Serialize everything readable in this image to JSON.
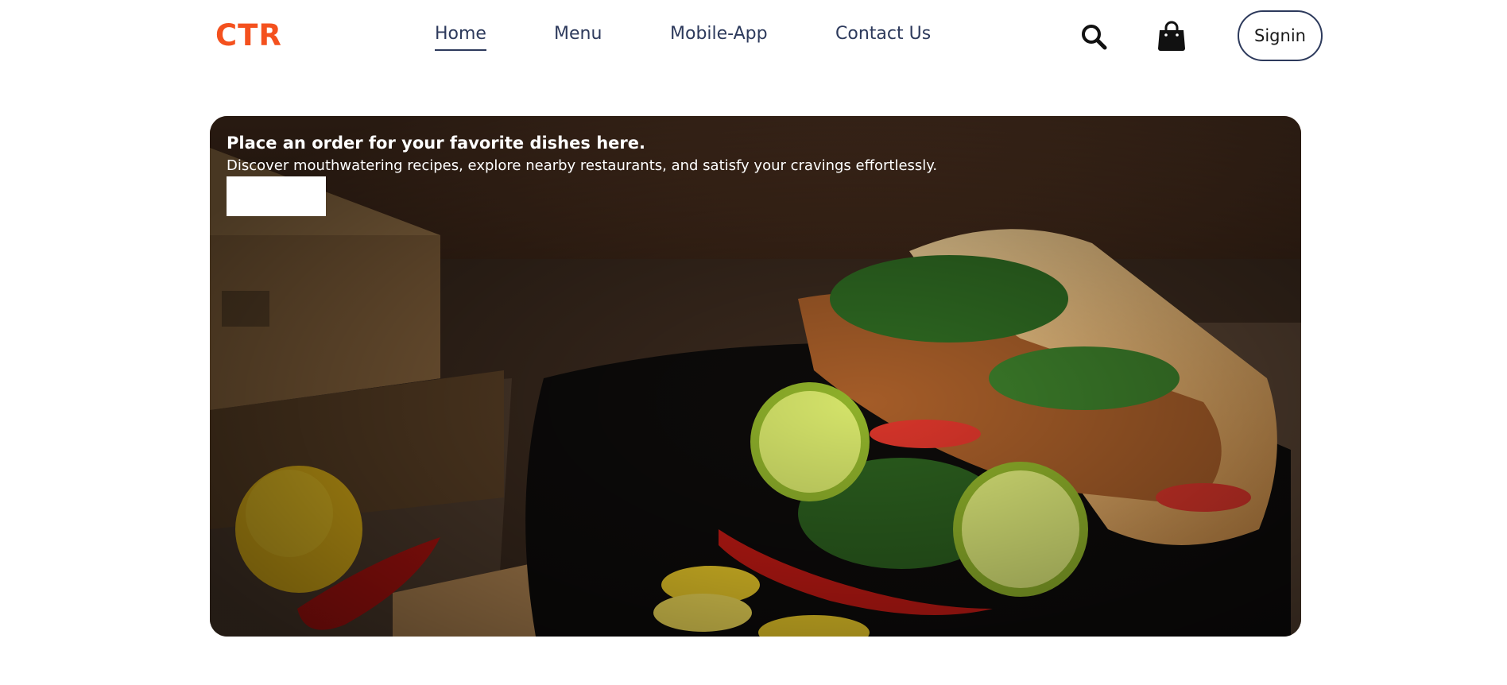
{
  "brand": {
    "logo_text": "CTR",
    "logo_color": "#f4511e"
  },
  "nav": {
    "items": [
      {
        "label": "Home",
        "active": true
      },
      {
        "label": "Menu",
        "active": false
      },
      {
        "label": "Mobile-App",
        "active": false
      },
      {
        "label": "Contact Us",
        "active": false
      }
    ],
    "text_color": "#2d3a5c"
  },
  "header_actions": {
    "search_icon": "search-icon",
    "bag_icon": "shopping-bag-icon",
    "signin_label": "Signin"
  },
  "hero": {
    "title": "Place an order for your favorite dishes here.",
    "subtitle": "Discover mouthwatering recipes, explore nearby restaurants, and satisfy your cravings effortlessly.",
    "cta_label": ""
  }
}
